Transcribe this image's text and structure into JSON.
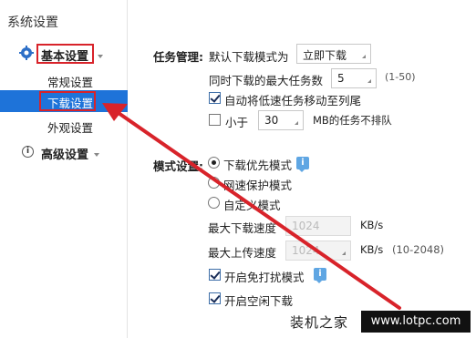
{
  "sidebar": {
    "title": "系统设置",
    "groups": [
      {
        "label": "基本设置",
        "items": [
          "常规设置",
          "下载设置",
          "外观设置"
        ]
      },
      {
        "label": "高级设置"
      }
    ],
    "selected_item": "下载设置"
  },
  "task_management": {
    "section_label": "任务管理:",
    "default_mode_label": "默认下载模式为",
    "default_mode_value": "立即下载",
    "max_tasks_label": "同时下载的最大任务数",
    "max_tasks_value": "5",
    "max_tasks_range": "(1-50)",
    "auto_move_label": "自动将低速任务移动至列尾",
    "auto_move_checked": true,
    "less_than_label": "小于",
    "less_than_checked": false,
    "less_than_value": "30",
    "less_than_suffix": "MB的任务不排队"
  },
  "mode_settings": {
    "section_label": "模式设置:",
    "options": [
      "下载优先模式",
      "网速保护模式",
      "自定义模式"
    ],
    "selected_option": "下载优先模式",
    "max_download_label": "最大下载速度",
    "max_download_value": "1024",
    "max_download_unit": "KB/s",
    "max_upload_label": "最大上传速度",
    "max_upload_value": "1024",
    "max_upload_unit": "KB/s",
    "max_upload_range": "(10-2048)",
    "no_disturb_label": "开启免打扰模式",
    "no_disturb_checked": true,
    "idle_download_label": "开启空闲下载",
    "idle_download_checked": true
  },
  "watermark": {
    "brand": "装机之家",
    "url": "www.lotpc.com"
  },
  "colors": {
    "selected_bg": "#1e73d9",
    "highlight_red": "#d8232a",
    "tip_blue": "#5fa6e3"
  }
}
